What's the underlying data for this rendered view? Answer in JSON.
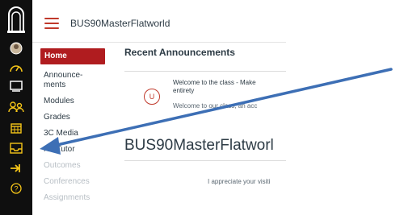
{
  "course_name": "BUS90MasterFlatworld",
  "course_nav": [
    {
      "label": "Home",
      "state": "active"
    },
    {
      "label": "Announce-\nments",
      "state": "normal"
    },
    {
      "label": "Modules",
      "state": "normal"
    },
    {
      "label": "Grades",
      "state": "obscured"
    },
    {
      "label": "3C Media",
      "state": "normal"
    },
    {
      "label": "NetTutor",
      "state": "normal"
    },
    {
      "label": "Outcomes",
      "state": "muted"
    },
    {
      "label": "Conferences",
      "state": "muted"
    },
    {
      "label": "Assignments",
      "state": "muted"
    }
  ],
  "recent_announcements": {
    "header": "Recent Announcements",
    "avatar_letter": "U",
    "title_line1": "Welcome to the class - Make",
    "title_line2": "entirety",
    "preview": "Welcome to our class, an acc"
  },
  "page_title": "BUS90MasterFlatworl",
  "page_text": "I appreciate your visiti",
  "colors": {
    "rail_bg": "#0f0f0f",
    "accent": "#b01c1f",
    "rail_icon": "#f5c518",
    "arrow": "#3d6fb5"
  },
  "rail_icons": [
    "college-logo-icon",
    "account-avatar-icon",
    "dashboard-icon",
    "courses-icon",
    "groups-icon",
    "calendar-icon",
    "inbox-icon",
    "commons-icon",
    "help-icon"
  ]
}
